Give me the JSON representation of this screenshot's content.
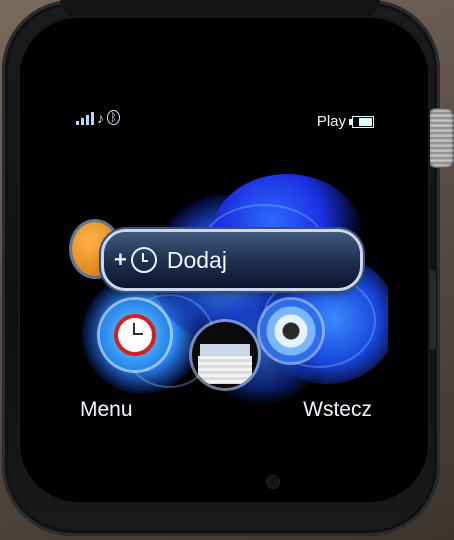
{
  "status_bar": {
    "left_icons": [
      "signal-icon",
      "music-note-icon",
      "bluetooth-icon"
    ],
    "play_label": "Play",
    "battery_level": 0.75
  },
  "popup": {
    "plus_symbol": "+",
    "icon": "alarm-clock-icon",
    "label": "Dodaj"
  },
  "app_icons": [
    "contacts-icon",
    "alarm-icon",
    "calendar-icon",
    "music-icon"
  ],
  "softkeys": {
    "left_label": "Menu",
    "right_label": "Wstecz"
  },
  "colors": {
    "accent_blue": "#2d6bff",
    "popup_bg": "#1d2e4e",
    "alarm_red": "#d51f1f"
  }
}
